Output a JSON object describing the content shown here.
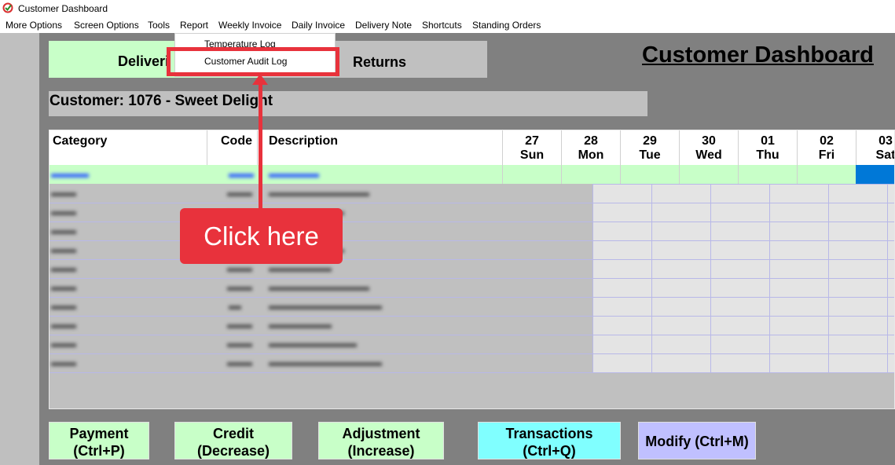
{
  "window": {
    "title": "Customer Dashboard",
    "icon": "app-logo-icon"
  },
  "menubar": [
    "More Options",
    "Screen Options",
    "Tools",
    "Report",
    "Weekly Invoice",
    "Daily Invoice",
    "Delivery Note",
    "Shortcuts",
    "Standing Orders"
  ],
  "dropdown": {
    "items": [
      "Temperature Log",
      "Customer Audit Log"
    ]
  },
  "tabs": {
    "deliveries": "Deliveri",
    "returns": "Returns"
  },
  "page_title": "Customer Dashboard",
  "customer": "Customer: 1076 - Sweet Delight",
  "grid": {
    "headers": {
      "category": "Category",
      "code": "Code",
      "description": "Description"
    },
    "days": [
      {
        "date": "27",
        "day": "Sun"
      },
      {
        "date": "28",
        "day": "Mon"
      },
      {
        "date": "29",
        "day": "Tue"
      },
      {
        "date": "30",
        "day": "Wed"
      },
      {
        "date": "01",
        "day": "Thu"
      },
      {
        "date": "02",
        "day": "Fri"
      },
      {
        "date": "03",
        "day": "Sat"
      }
    ]
  },
  "callout": "Click here",
  "buttons": {
    "payment": [
      "Payment",
      "(Ctrl+P)"
    ],
    "credit": [
      "Credit",
      "(Decrease)"
    ],
    "adjustment": [
      "Adjustment",
      "(Increase)"
    ],
    "transactions": [
      "Transactions",
      "(Ctrl+Q)"
    ],
    "modify": "Modify (Ctrl+M)"
  },
  "colors": {
    "green": "#c8ffc8",
    "cyan": "#80ffff",
    "lavender": "#c0c0ff",
    "callout_red": "#e8323c",
    "selected_blue": "#0078d7"
  }
}
